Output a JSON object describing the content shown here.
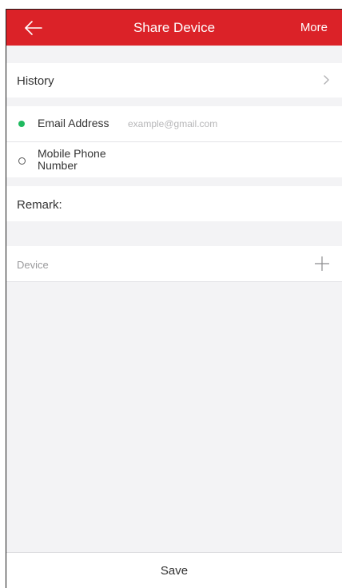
{
  "header": {
    "title": "Share Device",
    "more_label": "More",
    "back_icon": "arrow-left-icon",
    "background_color": "#db2228"
  },
  "history": {
    "label": "History",
    "icon": "chevron-right-icon"
  },
  "share_method": {
    "selected": "email",
    "accent_color": "#1fba5f",
    "options": [
      {
        "id": "email",
        "label": "Email Address",
        "placeholder": "example@gmail.com",
        "value": ""
      },
      {
        "id": "phone",
        "label_line1": "Mobile Phone",
        "label_line2": "Number"
      }
    ]
  },
  "remark": {
    "label": "Remark:"
  },
  "device": {
    "label": "Device",
    "add_icon": "plus-icon"
  },
  "footer": {
    "save_label": "Save"
  }
}
